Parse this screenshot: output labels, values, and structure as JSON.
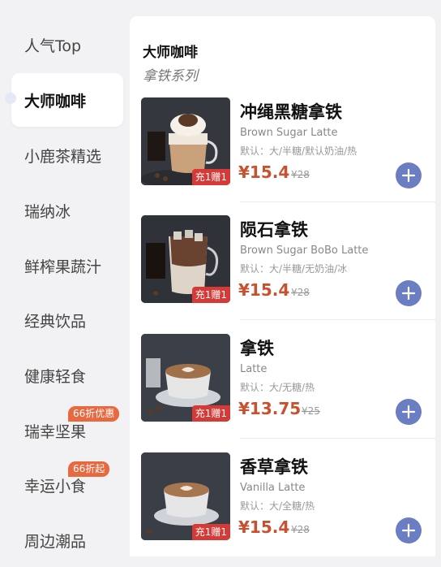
{
  "sidebar": {
    "items": [
      {
        "label": "人气Top"
      },
      {
        "label": "大师咖啡"
      },
      {
        "label": "小鹿茶精选"
      },
      {
        "label": "瑞纳冰"
      },
      {
        "label": "鲜榨果蔬汁"
      },
      {
        "label": "经典饮品"
      },
      {
        "label": "健康轻食"
      },
      {
        "label": "瑞幸坚果",
        "badge": "66折优惠"
      },
      {
        "label": "幸运小食",
        "badge": "66折起"
      },
      {
        "label": "周边潮品"
      }
    ],
    "badge_color": "#e8683f",
    "active_index": 1
  },
  "category": {
    "title": "大师咖啡",
    "subtitle": "拿铁系列"
  },
  "products": [
    {
      "name": "冲绳黑糖拿铁",
      "en": "Brown Sugar Latte",
      "default": "默认：大/半糖/默认奶油/热",
      "price": "¥15.4",
      "original": "¥28",
      "promo": "充1赠1",
      "image": "whipped-latte-image"
    },
    {
      "name": "陨石拿铁",
      "en": "Brown Sugar BoBo Latte",
      "default": "默认：大/半糖/无奶油/冰",
      "price": "¥15.4",
      "original": "¥28",
      "promo": "充1赠1",
      "image": "iced-latte-image"
    },
    {
      "name": "拿铁",
      "en": "Latte",
      "default": "默认：大/无糖/热",
      "price": "¥13.75",
      "original": "¥25",
      "promo": "充1赠1",
      "image": "latte-art-image"
    },
    {
      "name": "香草拿铁",
      "en": "Vanilla Latte",
      "default": "默认：大/全糖/热",
      "price": "¥15.4",
      "original": "¥28",
      "promo": "充1赠1",
      "image": "vanilla-latte-image"
    }
  ],
  "colors": {
    "price": "#c8512f",
    "add_button": "#6b7ec4",
    "promo": "#d63a37"
  }
}
